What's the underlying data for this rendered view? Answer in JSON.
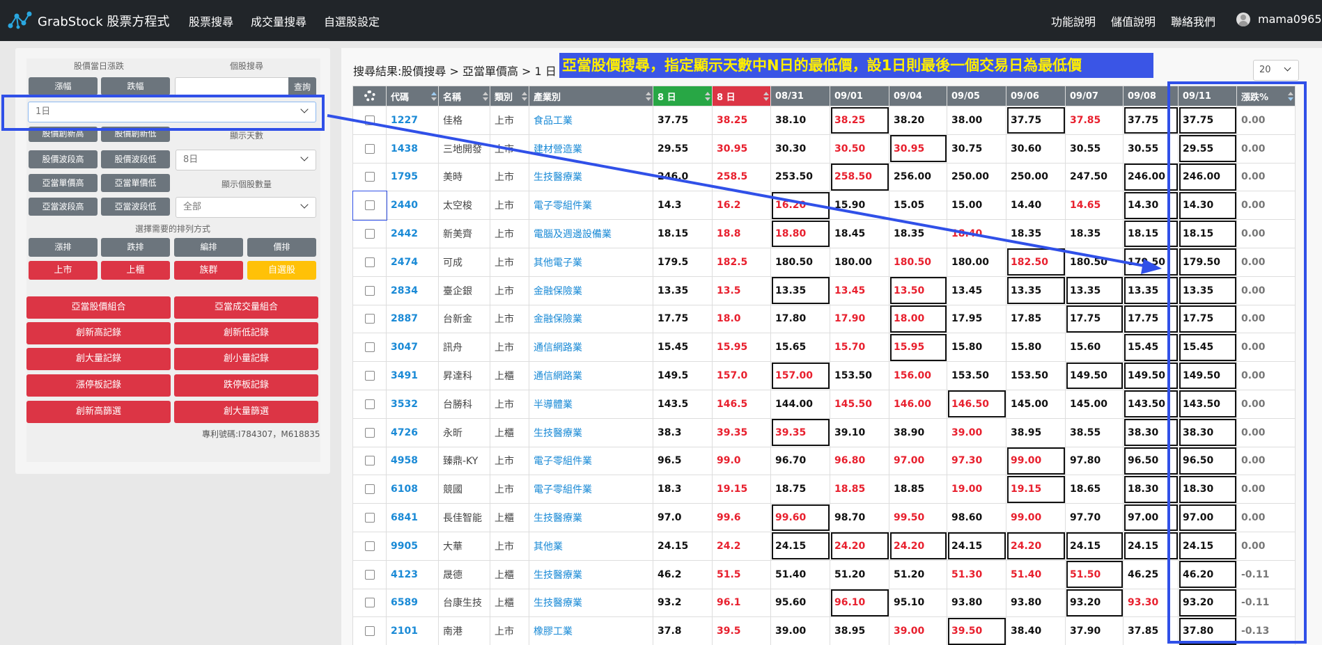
{
  "navbar": {
    "brand": "GrabStock 股票方程式",
    "menu": [
      "股票搜尋",
      "成交量搜尋",
      "自選股設定"
    ],
    "right_menu": [
      "功能說明",
      "儲值說明",
      "聯絡我們"
    ],
    "user": "mama0965"
  },
  "left_panel": {
    "header_change": "股價當日漲跌",
    "header_search": "個股搜尋",
    "btn_up": "漲幅",
    "btn_down": "跌幅",
    "search_button": "查詢",
    "days_select": "1日",
    "btn_new_high": "股價創新高",
    "btn_new_low": "股價創新低",
    "label_days": "顯示天數",
    "btn_wave_high": "股價波段高",
    "btn_wave_low": "股價波段低",
    "days_display_select": "8日",
    "btn_single_high": "亞當單價高",
    "btn_single_low": "亞當單價低",
    "label_count": "顯示個股數量",
    "btn_adam_wave_high": "亞當波段高",
    "btn_adam_wave_low": "亞當波段低",
    "count_select": "全部",
    "label_sort": "選擇需要的排列方式",
    "sort_buttons": [
      "漲排",
      "跌排",
      "編排",
      "價排"
    ],
    "market_buttons": [
      "上市",
      "上櫃",
      "族群",
      "自選股"
    ],
    "feature_buttons": [
      "亞當股價組合",
      "亞當成交量組合",
      "創新高記錄",
      "創新低記錄",
      "創大量記錄",
      "創小量記錄",
      "漲停板記錄",
      "跌停板記錄",
      "創新高篩選",
      "創大量篩選"
    ],
    "patent": "專利號碼:I784307，M618835"
  },
  "main": {
    "breadcrumb": "搜尋結果:股價搜尋 > 亞當單價高 > 1 日",
    "annotation": "亞當股價搜尋，指定顯示天數中N日的最低價，設1日則最後一個交易日為最低價",
    "page_size": "20",
    "columns": [
      "代碼",
      "名稱",
      "類別",
      "產業別",
      "8 日",
      "8 日",
      "08/31",
      "09/01",
      "09/04",
      "09/05",
      "09/06",
      "09/07",
      "09/08",
      "09/11",
      "漲跌%"
    ],
    "rows": [
      [
        "1227",
        "佳格",
        "上市",
        "食品工業",
        "37.75",
        "38.25",
        "38.10",
        "38.25",
        "38.20",
        "38.00",
        "37.75",
        "37.85",
        "37.75",
        "37.75",
        "0.00"
      ],
      [
        "1438",
        "三地開發",
        "上市",
        "建材營造業",
        "29.55",
        "30.95",
        "30.30",
        "30.50",
        "30.95",
        "30.75",
        "30.60",
        "30.55",
        "30.55",
        "29.55",
        "0.00"
      ],
      [
        "1795",
        "美時",
        "上市",
        "生技醫療業",
        "246.0",
        "258.5",
        "253.50",
        "258.50",
        "256.00",
        "250.00",
        "250.00",
        "247.50",
        "246.00",
        "246.00",
        "0.00"
      ],
      [
        "2440",
        "太空梭",
        "上市",
        "電子零組件業",
        "14.3",
        "16.2",
        "16.20",
        "15.90",
        "15.05",
        "15.00",
        "14.40",
        "14.65",
        "14.30",
        "14.30",
        "0.00"
      ],
      [
        "2442",
        "新美齊",
        "上市",
        "電腦及週邊設備業",
        "18.15",
        "18.8",
        "18.80",
        "18.45",
        "18.35",
        "18.40",
        "18.35",
        "18.35",
        "18.15",
        "18.15",
        "0.00"
      ],
      [
        "2474",
        "可成",
        "上市",
        "其他電子業",
        "179.5",
        "182.5",
        "180.50",
        "180.00",
        "180.50",
        "180.00",
        "182.50",
        "180.50",
        "179.50",
        "179.50",
        "0.00"
      ],
      [
        "2834",
        "臺企銀",
        "上市",
        "金融保險業",
        "13.35",
        "13.5",
        "13.35",
        "13.45",
        "13.50",
        "13.45",
        "13.35",
        "13.35",
        "13.35",
        "13.35",
        "0.00"
      ],
      [
        "2887",
        "台新金",
        "上市",
        "金融保險業",
        "17.75",
        "18.0",
        "17.80",
        "17.90",
        "18.00",
        "17.95",
        "17.85",
        "17.75",
        "17.75",
        "17.75",
        "0.00"
      ],
      [
        "3047",
        "訊舟",
        "上市",
        "通信網路業",
        "15.45",
        "15.95",
        "15.65",
        "15.70",
        "15.95",
        "15.80",
        "15.80",
        "15.60",
        "15.45",
        "15.45",
        "0.00"
      ],
      [
        "3491",
        "昇達科",
        "上櫃",
        "通信網路業",
        "149.5",
        "157.0",
        "157.00",
        "153.50",
        "156.00",
        "153.50",
        "153.50",
        "149.50",
        "149.50",
        "149.50",
        "0.00"
      ],
      [
        "3532",
        "台勝科",
        "上市",
        "半導體業",
        "143.5",
        "146.5",
        "144.00",
        "145.50",
        "146.00",
        "146.50",
        "145.00",
        "145.00",
        "143.50",
        "143.50",
        "0.00"
      ],
      [
        "4726",
        "永昕",
        "上櫃",
        "生技醫療業",
        "38.3",
        "39.35",
        "39.35",
        "39.10",
        "38.90",
        "39.00",
        "38.95",
        "38.55",
        "38.30",
        "38.30",
        "0.00"
      ],
      [
        "4958",
        "臻鼎-KY",
        "上市",
        "電子零組件業",
        "96.5",
        "99.0",
        "96.70",
        "96.80",
        "97.00",
        "97.30",
        "99.00",
        "97.80",
        "96.50",
        "96.50",
        "0.00"
      ],
      [
        "6108",
        "競國",
        "上市",
        "電子零組件業",
        "18.3",
        "19.15",
        "18.75",
        "18.85",
        "18.85",
        "19.00",
        "19.15",
        "18.65",
        "18.30",
        "18.30",
        "0.00"
      ],
      [
        "6841",
        "長佳智能",
        "上櫃",
        "生技醫療業",
        "97.0",
        "99.6",
        "99.60",
        "98.70",
        "99.50",
        "98.60",
        "99.00",
        "97.70",
        "97.00",
        "97.00",
        "0.00"
      ],
      [
        "9905",
        "大華",
        "上市",
        "其他業",
        "24.15",
        "24.2",
        "24.15",
        "24.20",
        "24.20",
        "24.15",
        "24.20",
        "24.15",
        "24.15",
        "24.15",
        "0.00"
      ],
      [
        "4123",
        "晟德",
        "上櫃",
        "生技醫療業",
        "46.2",
        "51.5",
        "51.40",
        "51.20",
        "51.20",
        "51.30",
        "51.40",
        "51.50",
        "46.25",
        "46.20",
        "-0.11"
      ],
      [
        "6589",
        "台康生技",
        "上櫃",
        "生技醫療業",
        "93.2",
        "96.1",
        "95.60",
        "96.10",
        "95.10",
        "93.80",
        "93.80",
        "93.20",
        "93.30",
        "93.20",
        "-0.11"
      ],
      [
        "2101",
        "南港",
        "上市",
        "橡膠工業",
        "37.8",
        "39.5",
        "39.00",
        "38.95",
        "39.00",
        "39.50",
        "38.40",
        "37.90",
        "37.85",
        "37.80",
        "-0.13"
      ]
    ]
  },
  "colors": {
    "navbar": "#212529",
    "gray_button": "#6c757d",
    "red_button": "#dc3545",
    "yellow_button": "#ffc107",
    "highlight": "#3050e8",
    "annotation_text": "#ffee00"
  }
}
